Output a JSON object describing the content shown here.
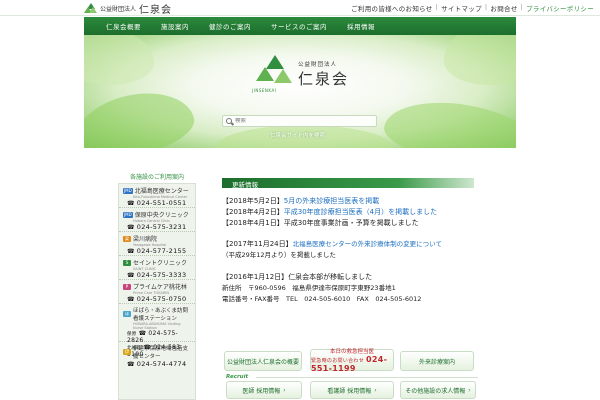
{
  "header": {
    "org": "公益財団法人",
    "name": "仁泉会",
    "links": [
      {
        "label": "ご利用の皆様へのお知らせ"
      },
      {
        "label": "サイトマップ"
      },
      {
        "label": "お問合せ"
      },
      {
        "label": "プライバシーポリシー"
      }
    ]
  },
  "nav": {
    "items": [
      {
        "label": "仁泉会概要"
      },
      {
        "label": "施設案内"
      },
      {
        "label": "健診のご案内"
      },
      {
        "label": "サービスのご案内"
      },
      {
        "label": "採用情報"
      }
    ]
  },
  "hero": {
    "org": "公益財団法人",
    "name": "仁泉会",
    "sub": "JINSENKAI",
    "search_placeholder": "検索",
    "search_caption": "仁泉会サイト内を検索"
  },
  "sidebar": {
    "title": "各施設のご利用案内",
    "facilities": [
      {
        "badge": "JMD",
        "name": "北福島医療センター",
        "sub": "Kita-Fukushima Medical Center",
        "tel": "024-551-0551"
      },
      {
        "badge": "JMD",
        "name": "保原中央クリニック",
        "sub": "Hobara Central Clinic",
        "tel": "024-575-3231"
      },
      {
        "badge": "梁",
        "name": "梁川病院",
        "sub": "Yanagawa Hospital",
        "tel": "024-577-2155"
      },
      {
        "badge": "S",
        "name": "セイントクリニック",
        "sub": "SAINT CLINIC",
        "tel": "024-575-3333"
      },
      {
        "badge": "P",
        "name": "プライムケア桃花林",
        "sub": "Prime Care TOKARIN",
        "tel": "024-575-0750"
      },
      {
        "badge": "ほ",
        "name": "ほばら・あぶくま訪問看護ステーション",
        "sub": "HOBARA-ABUKUMA Visiting Nurse Station",
        "tel1_label": "保原",
        "tel1": "024-575-2826",
        "tel2_label": "北福島",
        "tel2": "024-583-5100"
      },
      {
        "badge": "伊",
        "name": "伊達市保原地域包括支援センター",
        "sub": "",
        "tel": "024-574-4774"
      }
    ]
  },
  "news": {
    "title": "更新情報",
    "entries": [
      {
        "date": "【2018年5月2日】",
        "text": "",
        "link": "5月の外来診療担当医表を掲載",
        "tail": ""
      },
      {
        "date": "【2018年4月2日】",
        "text": "",
        "link": "平成30年度診療担当医表（4月）を掲載しました",
        "tail": ""
      },
      {
        "date": "【2018年4月1日】",
        "text": "平成30年度事業計画・予算を掲載しました",
        "link": "",
        "tail": ""
      },
      {
        "date": "【2017年11月24日】",
        "text": "",
        "link": "北福島医療センターの外来診療体制の変更について",
        "tail": "（平成29年12月より）を掲載しました"
      },
      {
        "date": "【2016年1月12日】",
        "text": "仁泉会本部が移転しました",
        "link": "",
        "tail": ""
      }
    ],
    "address_line1": "新住所　〒960-0596　福島県伊達市保原町字東野23番地1",
    "address_line2": "電話番号・FAX番号　TEL　024-505-6010　FAX　024-505-6012"
  },
  "banners": {
    "b1": "公益財団法人仁泉会の概要",
    "b2_title": "本日の救急担当医",
    "b2_prefix": "緊急時のお問い合わせ",
    "b2_tel": "024-551-1199",
    "b3": "外来診療案内",
    "recruit_label": "Recruit",
    "r1": "医師 採用情報",
    "r2": "看護師 採用情報",
    "r3": "その他施設の求人情報"
  }
}
